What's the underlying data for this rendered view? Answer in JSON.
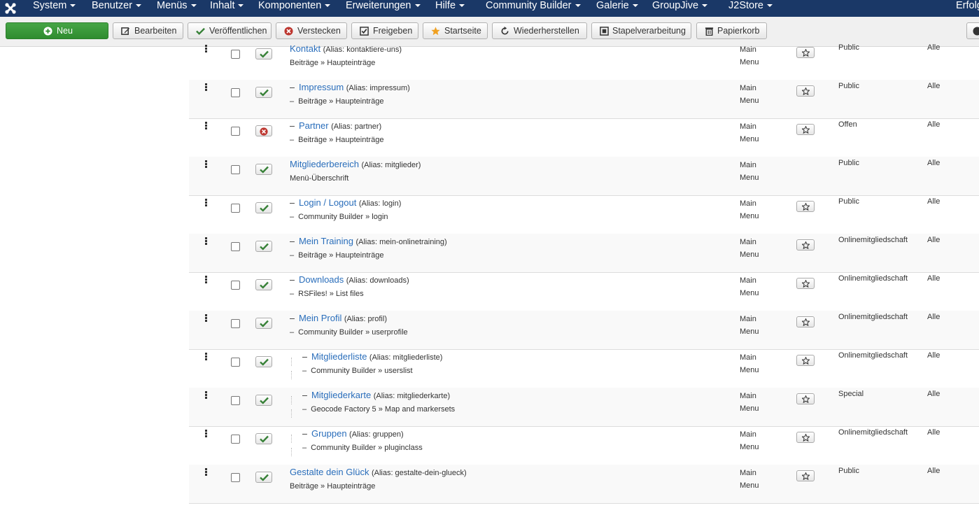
{
  "nav": {
    "items": [
      "System",
      "Benutzer",
      "Menüs",
      "Inhalt",
      "Komponenten",
      "Erweiterungen",
      "Hilfe",
      "Community Builder",
      "Galerie",
      "GroupJive",
      "J2Store"
    ],
    "right_text": "Erfolg"
  },
  "toolbar": {
    "new": "Neu",
    "edit": "Bearbeiten",
    "publish": "Veröffentlichen",
    "unpublish": "Verstecken",
    "checkin": "Freigeben",
    "home": "Startseite",
    "rebuild": "Wiederherstellen",
    "batch": "Stapelverarbeitung",
    "trash": "Papierkorb"
  },
  "rows": [
    {
      "title": "Kontakt",
      "alias": "(Alias: kontaktiere-uns)",
      "type": "Beiträge » Haupteinträge",
      "level": 0,
      "state": "published",
      "menu_line1": "Main",
      "menu_line2": "Menu",
      "home": true,
      "access": "Public",
      "language": "Alle"
    },
    {
      "title": "Impressum",
      "alias": "(Alias: impressum)",
      "type": "Beiträge » Haupteinträge",
      "level": 1,
      "state": "published",
      "menu_line1": "Main",
      "menu_line2": "Menu",
      "home": true,
      "access": "Public",
      "language": "Alle"
    },
    {
      "title": "Partner",
      "alias": "(Alias: partner)",
      "type": "Beiträge » Haupteinträge",
      "level": 1,
      "state": "unpublished",
      "menu_line1": "Main",
      "menu_line2": "Menu",
      "home": true,
      "access": "Offen",
      "language": "Alle"
    },
    {
      "title": "Mitgliederbereich",
      "alias": "(Alias: mitglieder)",
      "type": "Menü-Überschrift",
      "level": 0,
      "state": "published",
      "menu_line1": "Main",
      "menu_line2": "Menu",
      "home": false,
      "access": "Public",
      "language": "Alle"
    },
    {
      "title": "Login / Logout",
      "alias": "(Alias: login)",
      "type": "Community Builder » login",
      "level": 1,
      "state": "published",
      "menu_line1": "Main",
      "menu_line2": "Menu",
      "home": true,
      "access": "Public",
      "language": "Alle"
    },
    {
      "title": "Mein Training",
      "alias": "(Alias: mein-onlinetraining)",
      "type": "Beiträge » Haupteinträge",
      "level": 1,
      "state": "published",
      "menu_line1": "Main",
      "menu_line2": "Menu",
      "home": true,
      "access": "Onlinemitgliedschaft",
      "language": "Alle"
    },
    {
      "title": "Downloads",
      "alias": "(Alias: downloads)",
      "type": "RSFiles! » List files",
      "level": 1,
      "state": "published",
      "menu_line1": "Main",
      "menu_line2": "Menu",
      "home": true,
      "access": "Onlinemitgliedschaft",
      "language": "Alle"
    },
    {
      "title": "Mein Profil",
      "alias": "(Alias: profil)",
      "type": "Community Builder » userprofile",
      "level": 1,
      "state": "published",
      "menu_line1": "Main",
      "menu_line2": "Menu",
      "home": true,
      "access": "Onlinemitgliedschaft",
      "language": "Alle"
    },
    {
      "title": "Mitgliederliste",
      "alias": "(Alias: mitgliederliste)",
      "type": "Community Builder » userslist",
      "level": 2,
      "state": "published",
      "menu_line1": "Main",
      "menu_line2": "Menu",
      "home": true,
      "access": "Onlinemitgliedschaft",
      "language": "Alle"
    },
    {
      "title": "Mitgliederkarte",
      "alias": "(Alias: mitgliederkarte)",
      "type": "Geocode Factory 5 » Map and markersets",
      "level": 2,
      "state": "published",
      "menu_line1": "Main",
      "menu_line2": "Menu",
      "home": true,
      "access": "Special",
      "language": "Alle"
    },
    {
      "title": "Gruppen",
      "alias": "(Alias: gruppen)",
      "type": "Community Builder » pluginclass",
      "level": 2,
      "state": "published",
      "menu_line1": "Main",
      "menu_line2": "Menu",
      "home": true,
      "access": "Onlinemitgliedschaft",
      "language": "Alle"
    },
    {
      "title": "Gestalte dein Glück",
      "alias": "(Alias: gestalte-dein-glueck)",
      "type": "Beiträge » Haupteinträge",
      "level": 0,
      "state": "published",
      "menu_line1": "Main",
      "menu_line2": "Menu",
      "home": true,
      "access": "Public",
      "language": "Alle"
    }
  ]
}
